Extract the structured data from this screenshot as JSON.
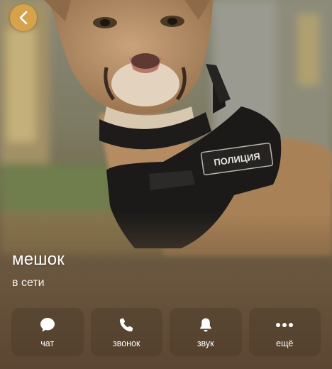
{
  "profile": {
    "name": "мешок",
    "status": "в сети"
  },
  "photo": {
    "patch_text": "ПОЛИЦИЯ"
  },
  "actions": [
    {
      "label": "чат",
      "icon": "chat-bubble-icon"
    },
    {
      "label": "звонок",
      "icon": "phone-icon"
    },
    {
      "label": "звук",
      "icon": "bell-icon"
    },
    {
      "label": "ещё",
      "icon": "more-dots-icon"
    }
  ],
  "colors": {
    "back_button": "#d6a24a",
    "text": "#ffffff",
    "action_bg": "rgba(70,55,40,0.38)"
  }
}
